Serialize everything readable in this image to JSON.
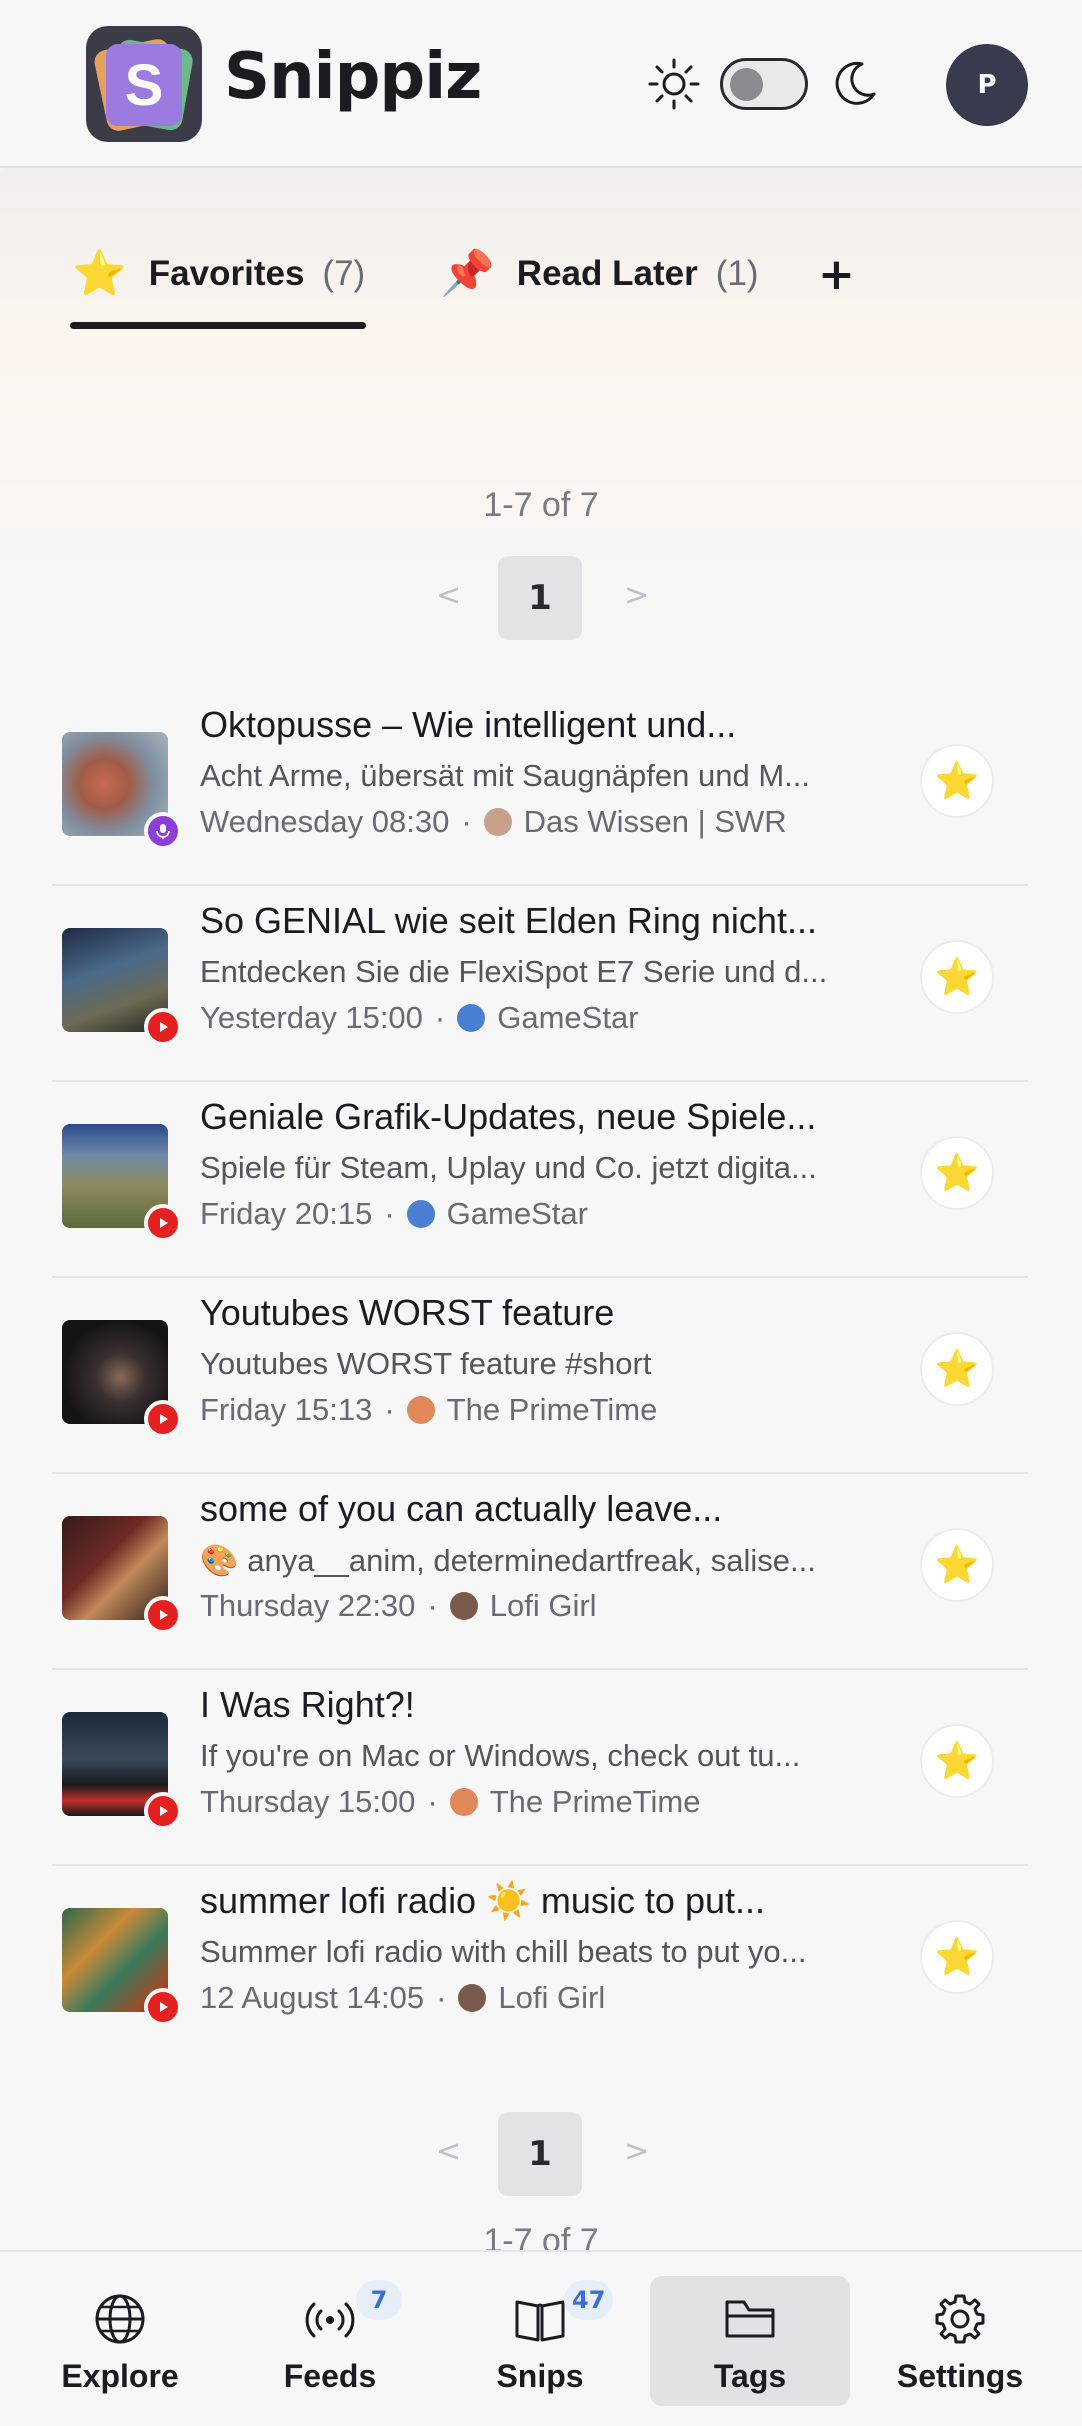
{
  "header": {
    "app_title": "Snippiz",
    "logo_letter": "S",
    "avatar_initial": "P",
    "theme_toggle_state": "light"
  },
  "tabs": [
    {
      "emoji": "⭐",
      "label": "Favorites",
      "count": "(7)",
      "active": true
    },
    {
      "emoji": "📌",
      "label": "Read Later",
      "count": "(1)",
      "active": false
    },
    {
      "label": "+"
    }
  ],
  "pagination": {
    "range": "1-7 of 7",
    "prev": "<",
    "next": ">",
    "current_page": "1"
  },
  "items": [
    {
      "title": "Oktopusse – Wie intelligent und...",
      "description": "Acht Arme, übersät mit Saugnäpfen und M...",
      "time": "Wednesday 08:30",
      "source": "Das Wissen | SWR",
      "type": "podcast",
      "starred": true
    },
    {
      "title": "So GENIAL wie seit Elden Ring nicht...",
      "description": "Entdecken Sie die FlexiSpot E7 Serie und d...",
      "time": "Yesterday 15:00",
      "source": "GameStar",
      "type": "youtube",
      "starred": true
    },
    {
      "title": "Geniale Grafik-Updates, neue Spiele...",
      "description": "Spiele für Steam, Uplay und Co. jetzt digita...",
      "time": "Friday 20:15",
      "source": "GameStar",
      "type": "youtube",
      "starred": true
    },
    {
      "title": "Youtubes WORST feature",
      "description": "Youtubes WORST feature #short",
      "time": "Friday 15:13",
      "source": "The PrimeTime",
      "type": "youtube",
      "starred": true
    },
    {
      "title": "some of you can actually leave...",
      "description": "🎨 anya__anim, determinedartfreak, salise...",
      "time": "Thursday 22:30",
      "source": "Lofi Girl",
      "type": "youtube",
      "starred": true
    },
    {
      "title": "I Was Right?!",
      "description": "If you're on Mac or Windows, check out tu...",
      "time": "Thursday 15:00",
      "source": "The PrimeTime",
      "type": "youtube",
      "starred": true
    },
    {
      "title": "summer lofi radio ☀️ music to put...",
      "description": "Summer lofi radio with chill beats to put yo...",
      "time": "12 August 14:05",
      "source": "Lofi Girl",
      "type": "youtube",
      "starred": true
    }
  ],
  "bottom_nav": [
    {
      "label": "Explore",
      "icon": "globe-icon",
      "badge": null
    },
    {
      "label": "Feeds",
      "icon": "broadcast-icon",
      "badge": "7"
    },
    {
      "label": "Snips",
      "icon": "book-icon",
      "badge": "47"
    },
    {
      "label": "Tags",
      "icon": "folder-icon",
      "badge": null,
      "active": true
    },
    {
      "label": "Settings",
      "icon": "gear-icon",
      "badge": null
    }
  ],
  "colors": {
    "youtube_badge": "#e52020",
    "podcast_badge": "#8b3fd6",
    "nav_badge_text": "#3b6fd8",
    "avatar_bg": "#3a3a4e"
  }
}
